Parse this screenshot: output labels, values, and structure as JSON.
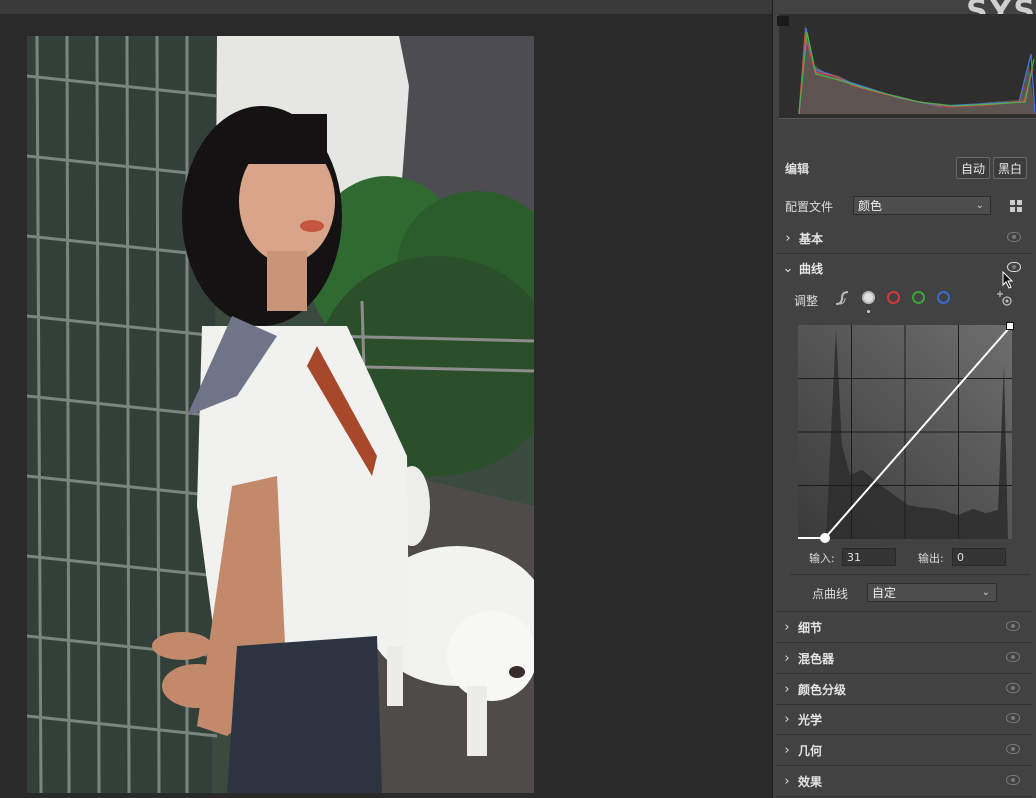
{
  "app": {
    "logo_text": "SYS"
  },
  "edit": {
    "title": "编辑",
    "auto_label": "自动",
    "bw_label": "黑白"
  },
  "profile": {
    "label": "配置文件",
    "value": "颜色"
  },
  "sections": {
    "basic": "基本",
    "curve": "曲线",
    "detail": "细节",
    "mixer": "混色器",
    "grading": "颜色分级",
    "optics": "光学",
    "geometry": "几何",
    "effects": "效果"
  },
  "curve": {
    "adjust_label": "调整",
    "input_label": "输入:",
    "input_value": "31",
    "output_label": "输出:",
    "output_value": "0",
    "point_curve_label": "点曲线",
    "point_curve_value": "自定",
    "channels": [
      "parametric",
      "rgb",
      "red",
      "green",
      "blue"
    ],
    "channel_colors": {
      "red": "#d03a3a",
      "green": "#3aa33a",
      "blue": "#3a6ad0",
      "rgb": "#e0e0e0"
    }
  }
}
